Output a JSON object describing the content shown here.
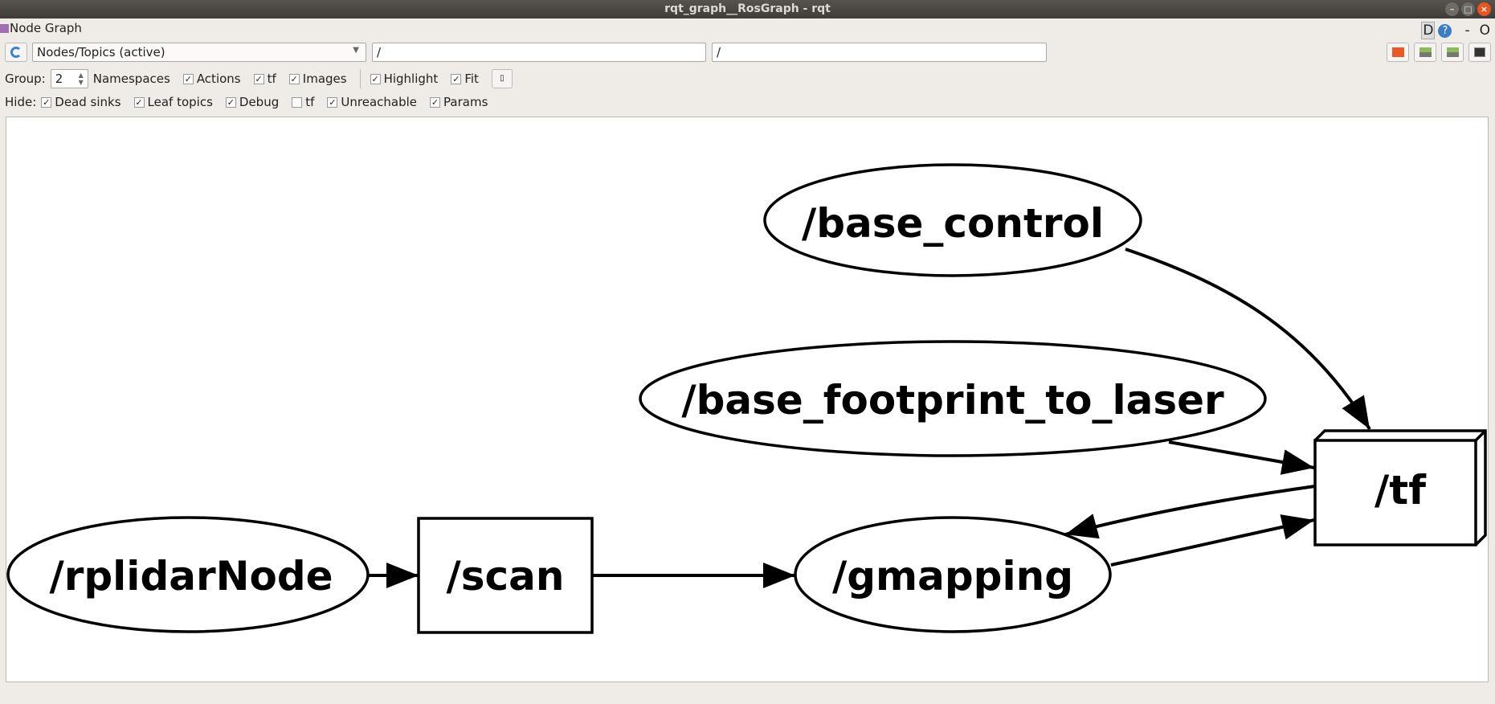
{
  "window": {
    "title": "rqt_graph__RosGraph - rqt"
  },
  "plugin": {
    "title": "Node Graph",
    "d_label": "D",
    "help": "?",
    "dash": "-",
    "o": "O"
  },
  "toolbar": {
    "mode": "Nodes/Topics (active)",
    "filter1": "/",
    "filter2": "/"
  },
  "group": {
    "label": "Group:",
    "value": "2",
    "namespaces": "Namespaces",
    "actions": "Actions",
    "tf": "tf",
    "images": "Images",
    "highlight": "Highlight",
    "fit": "Fit"
  },
  "hide": {
    "label": "Hide:",
    "items": [
      {
        "label": "Dead sinks",
        "checked": true
      },
      {
        "label": "Leaf topics",
        "checked": true
      },
      {
        "label": "Debug",
        "checked": true
      },
      {
        "label": "tf",
        "checked": false
      },
      {
        "label": "Unreachable",
        "checked": true
      },
      {
        "label": "Params",
        "checked": true
      }
    ]
  },
  "graph": {
    "nodes": {
      "base_control": "/base_control",
      "base_footprint_to_laser": "/base_footprint_to_laser",
      "rplidar": "/rplidarNode",
      "gmapping": "/gmapping"
    },
    "topics": {
      "scan": "/scan",
      "tf": "/tf"
    }
  }
}
